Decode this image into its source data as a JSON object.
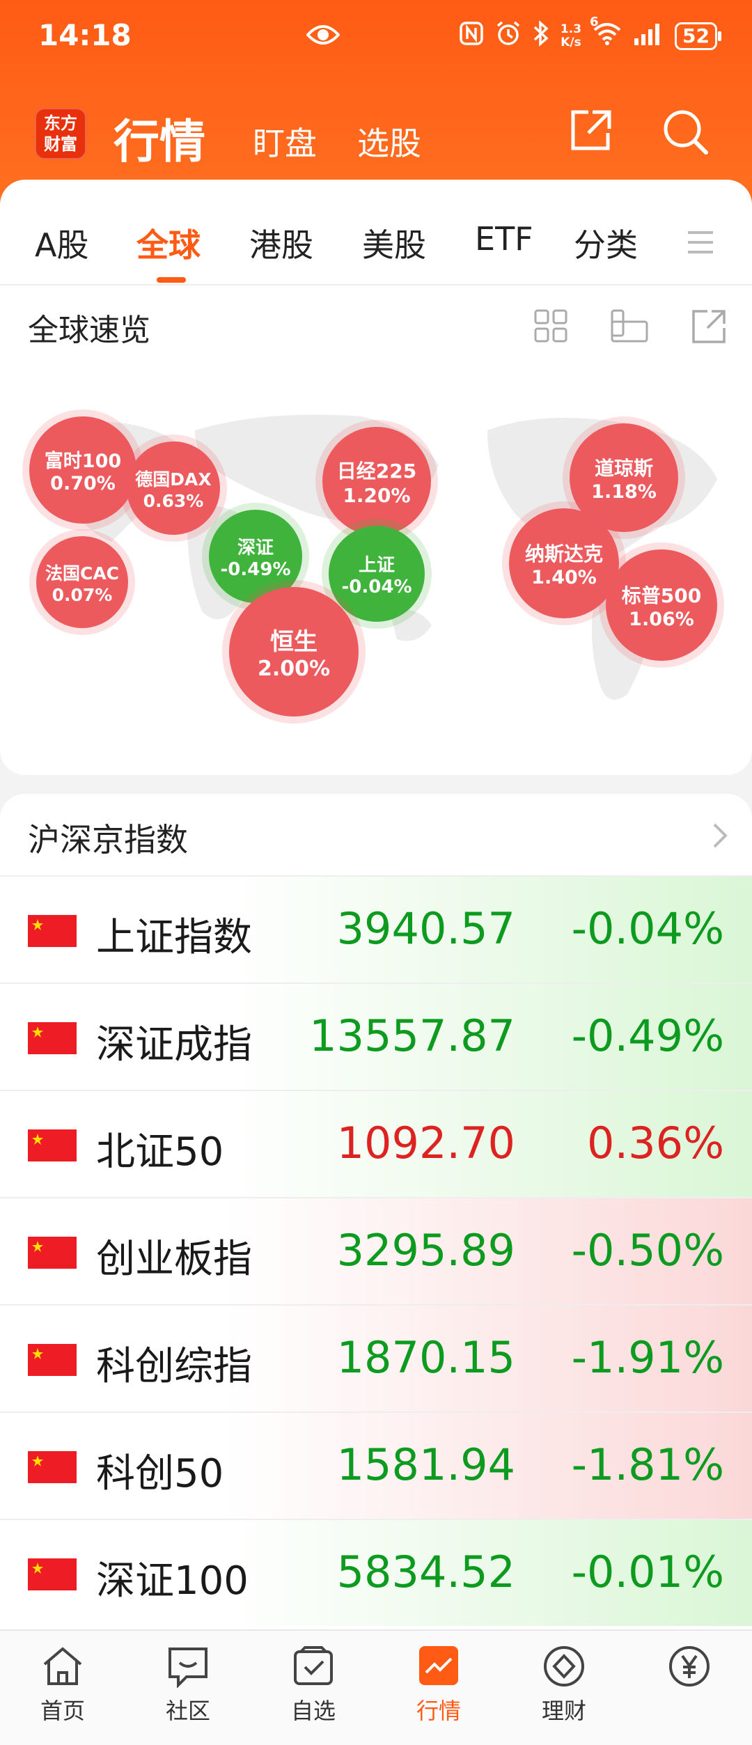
{
  "status_bar": {
    "time": "14:18",
    "net_speed_value": "1.3",
    "net_speed_unit": "K/s",
    "wifi_gen": "6",
    "battery": "52"
  },
  "header": {
    "logo_line1": "东方",
    "logo_line2": "财富",
    "title": "行情",
    "tab_watch": "盯盘",
    "tab_pick": "选股"
  },
  "tabs": [
    {
      "label": "A股"
    },
    {
      "label": "全球"
    },
    {
      "label": "港股"
    },
    {
      "label": "美股"
    },
    {
      "label": "ETF"
    },
    {
      "label": "分类"
    }
  ],
  "global": {
    "title": "全球速览",
    "bubbles": [
      {
        "name": "富时100",
        "change": "0.70%"
      },
      {
        "name": "德国DAX",
        "change": "0.63%"
      },
      {
        "name": "法国CAC",
        "change": "0.07%"
      },
      {
        "name": "深证",
        "change": "-0.49%"
      },
      {
        "name": "日经225",
        "change": "1.20%"
      },
      {
        "name": "上证",
        "change": "-0.04%"
      },
      {
        "name": "恒生",
        "change": "2.00%"
      },
      {
        "name": "道琼斯",
        "change": "1.18%"
      },
      {
        "name": "纳斯达克",
        "change": "1.40%"
      },
      {
        "name": "标普500",
        "change": "1.06%"
      }
    ]
  },
  "indices": {
    "title": "沪深京指数",
    "rows": [
      {
        "name": "上证指数",
        "price": "3940.57",
        "change": "-0.04%"
      },
      {
        "name": "深证成指",
        "price": "13557.87",
        "change": "-0.49%"
      },
      {
        "name": "北证50",
        "price": "1092.70",
        "change": "0.36%"
      },
      {
        "name": "创业板指",
        "price": "3295.89",
        "change": "-0.50%"
      },
      {
        "name": "科创综指",
        "price": "1870.15",
        "change": "-1.91%"
      },
      {
        "name": "科创50",
        "price": "1581.94",
        "change": "-1.81%"
      },
      {
        "name": "深证100",
        "price": "5834.52",
        "change": "-0.01%"
      }
    ]
  },
  "nav": [
    {
      "label": "首页"
    },
    {
      "label": "社区"
    },
    {
      "label": "自选"
    },
    {
      "label": "行情"
    },
    {
      "label": "理财"
    },
    {
      "label": ""
    }
  ],
  "colors": {
    "brand": "#ff5b15",
    "up_red": "#dd2222",
    "down_green": "#0c9a1f"
  },
  "icons": [
    "eye-icon",
    "nfc-icon",
    "alarm-icon",
    "bluetooth-icon",
    "wifi-icon",
    "signal-icon",
    "share-icon",
    "search-icon",
    "menu-icon",
    "grid-icon",
    "layout-icon",
    "chevron-right-icon",
    "home-icon",
    "community-icon",
    "watchlist-icon",
    "market-icon",
    "finance-icon",
    "yuan-icon"
  ]
}
